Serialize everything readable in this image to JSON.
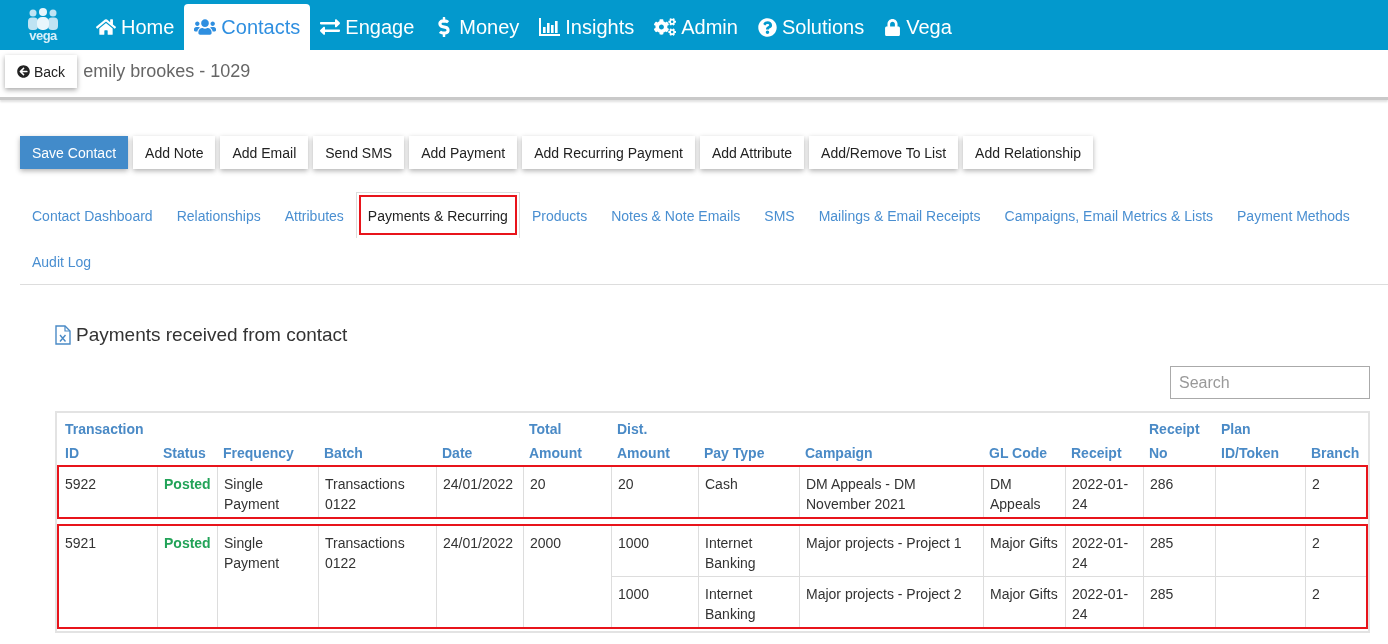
{
  "nav": {
    "logo_text": "vega",
    "items": [
      {
        "label": "Home",
        "selected": false
      },
      {
        "label": "Contacts",
        "selected": true
      },
      {
        "label": "Engage",
        "selected": false
      },
      {
        "label": "Money",
        "selected": false
      },
      {
        "label": "Insights",
        "selected": false
      },
      {
        "label": "Admin",
        "selected": false
      },
      {
        "label": "Solutions",
        "selected": false
      },
      {
        "label": "Vega",
        "selected": false
      }
    ]
  },
  "header": {
    "back_button": "Back",
    "title": "emily brookes - 1029"
  },
  "toolbar": {
    "buttons": [
      {
        "label": "Save Contact",
        "kind": "primary"
      },
      {
        "label": "Add Note",
        "kind": "default"
      },
      {
        "label": "Add Email",
        "kind": "default"
      },
      {
        "label": "Send SMS",
        "kind": "default"
      },
      {
        "label": "Add Payment",
        "kind": "default"
      },
      {
        "label": "Add Recurring Payment",
        "kind": "default"
      },
      {
        "label": "Add Attribute",
        "kind": "default"
      },
      {
        "label": "Add/Remove To List",
        "kind": "default"
      },
      {
        "label": "Add Relationship",
        "kind": "default"
      }
    ]
  },
  "tabs": [
    {
      "label": "Contact Dashboard",
      "selected": false,
      "highlighted": false
    },
    {
      "label": "Relationships",
      "selected": false,
      "highlighted": false
    },
    {
      "label": "Attributes",
      "selected": false,
      "highlighted": false
    },
    {
      "label": "Payments & Recurring",
      "selected": true,
      "highlighted": true
    },
    {
      "label": "Products",
      "selected": false,
      "highlighted": false
    },
    {
      "label": "Notes & Note Emails",
      "selected": false,
      "highlighted": false
    },
    {
      "label": "SMS",
      "selected": false,
      "highlighted": false
    },
    {
      "label": "Mailings & Email Receipts",
      "selected": false,
      "highlighted": false
    },
    {
      "label": "Campaigns, Email Metrics & Lists",
      "selected": false,
      "highlighted": false
    },
    {
      "label": "Payment Methods",
      "selected": false,
      "highlighted": false
    },
    {
      "label": "Audit Log",
      "selected": false,
      "highlighted": false
    }
  ],
  "section": {
    "title": "Payments received from contact"
  },
  "search": {
    "placeholder": "Search"
  },
  "table": {
    "columns": [
      "Transaction ID",
      "Status",
      "Frequency",
      "Batch",
      "Date",
      "Total Amount",
      "Dist. Amount",
      "Pay Type",
      "Campaign",
      "GL Code",
      "Receipt",
      "Receipt No",
      "Plan ID/Token",
      "Branch"
    ],
    "transactions": [
      {
        "id": "5922",
        "status": "Posted",
        "frequency": "Single Payment",
        "batch": "Transactions 0122",
        "date": "24/01/2022",
        "total_amount": "20",
        "highlighted": true,
        "distributions": [
          {
            "dist_amount": "20",
            "pay_type": "Cash",
            "campaign": "DM Appeals - DM November 2021",
            "gl_code": "DM Appeals",
            "receipt": "2022-01-24",
            "receipt_no": "286",
            "branch": "2"
          }
        ]
      },
      {
        "id": "5921",
        "status": "Posted",
        "frequency": "Single Payment",
        "batch": "Transactions 0122",
        "date": "24/01/2022",
        "total_amount": "2000",
        "highlighted": true,
        "distributions": [
          {
            "dist_amount": "1000",
            "pay_type": "Internet Banking",
            "campaign": "Major projects - Project 1",
            "gl_code": "Major Gifts",
            "receipt": "2022-01-24",
            "receipt_no": "285",
            "branch": "2"
          },
          {
            "dist_amount": "1000",
            "pay_type": "Internet Banking",
            "campaign": "Major projects - Project 2",
            "gl_code": "Major Gifts",
            "receipt": "2022-01-24",
            "receipt_no": "285",
            "branch": "2"
          }
        ]
      }
    ]
  }
}
